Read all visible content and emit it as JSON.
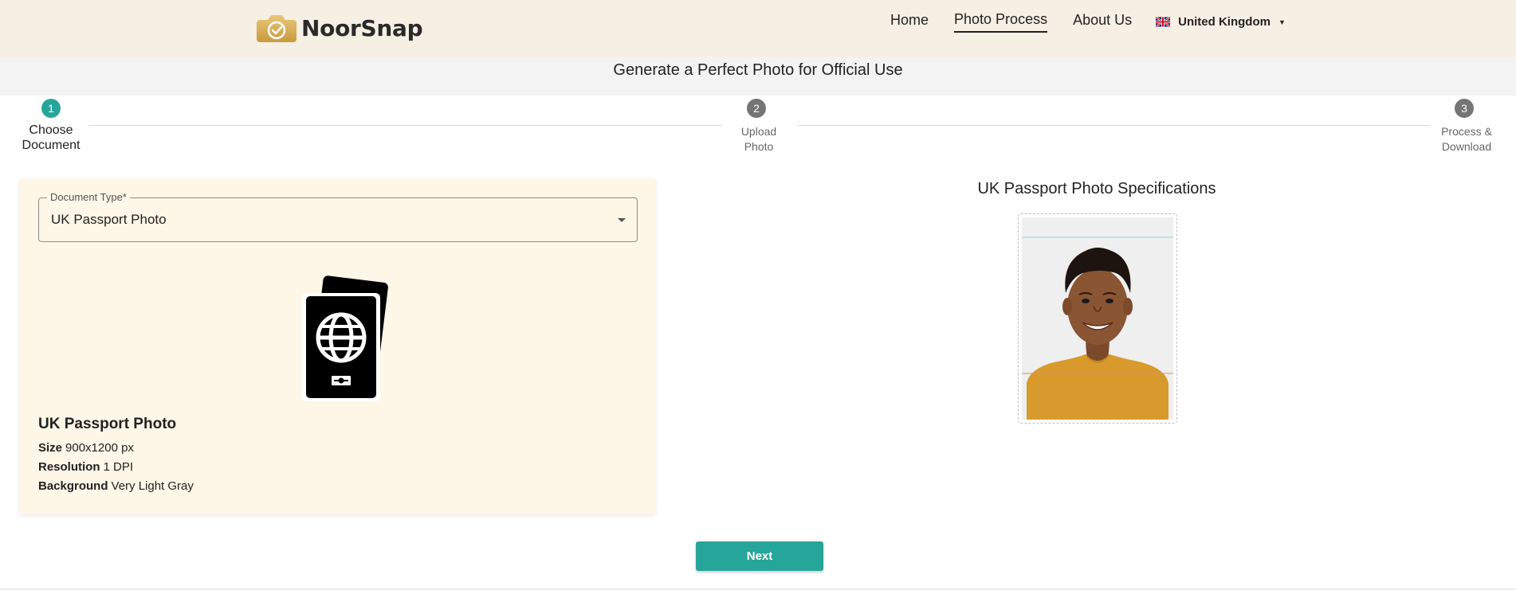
{
  "header": {
    "brand": "NoorSnap",
    "nav": [
      {
        "label": "Home"
      },
      {
        "label": "Photo Process"
      },
      {
        "label": "About Us"
      }
    ],
    "active_nav": "Photo Process",
    "language": "United Kingdom"
  },
  "page_title": "Generate a Perfect Photo for Official Use",
  "stepper": {
    "steps": [
      {
        "number": "1",
        "line1": "Choose",
        "line2": "Document"
      },
      {
        "number": "2",
        "line1": "Upload",
        "line2": "Photo"
      },
      {
        "number": "3",
        "line1": "Process &",
        "line2": "Download"
      }
    ],
    "active_step": 1
  },
  "document": {
    "field_label": "Document Type*",
    "selected": "UK Passport Photo",
    "title": "UK Passport Photo",
    "specs": [
      {
        "label": "Size",
        "value": "900x1200 px"
      },
      {
        "label": "Resolution",
        "value": "1 DPI"
      },
      {
        "label": "Background",
        "value": "Very Light Gray"
      }
    ]
  },
  "preview": {
    "title": "UK Passport Photo Specifications"
  },
  "actions": {
    "next_label": "Next"
  },
  "colors": {
    "header_bg": "#f6efe3",
    "accent": "#26a69a",
    "card_bg": "#fef6e6",
    "inactive_step": "#757575"
  }
}
